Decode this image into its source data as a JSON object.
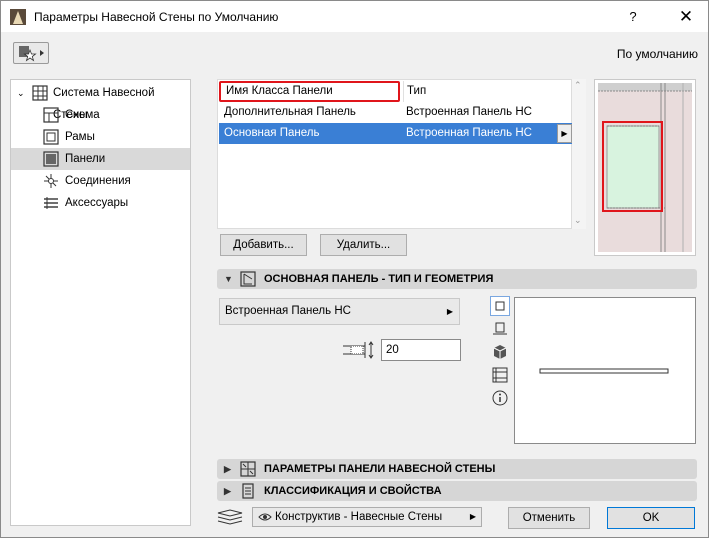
{
  "window": {
    "title": "Параметры Навесной Стены по Умолчанию",
    "help_label": "?",
    "close_label": "✕"
  },
  "header": {
    "default_label": "По умолчанию"
  },
  "tree": {
    "root_label": "Система Навесной Стены",
    "items": [
      {
        "label": "Схема",
        "icon": "scheme-icon"
      },
      {
        "label": "Рамы",
        "icon": "frames-icon"
      },
      {
        "label": "Панели",
        "icon": "panels-icon",
        "selected": true
      },
      {
        "label": "Соединения",
        "icon": "junctions-icon"
      },
      {
        "label": "Аксессуары",
        "icon": "accessories-icon"
      }
    ]
  },
  "panel_table": {
    "col_name": "Имя Класса Панели",
    "col_type": "Тип",
    "rows": [
      {
        "name": "Дополнительная Панель",
        "type": "Встроенная Панель НС",
        "selected": false
      },
      {
        "name": "Основная Панель",
        "type": "Встроенная Панель НС",
        "selected": true
      }
    ]
  },
  "buttons": {
    "add": "Добавить...",
    "delete": "Удалить...",
    "cancel": "Отменить",
    "ok": "OK"
  },
  "sections": {
    "type_geometry": "ОСНОВНАЯ ПАНЕЛЬ - ТИП И ГЕОМЕТРИЯ",
    "panel_params": "ПАРАМЕТРЫ ПАНЕЛИ НАВЕСНОЙ СТЕНЫ",
    "classification": "КЛАССИФИКАЦИЯ И СВОЙСТВА"
  },
  "geometry": {
    "panel_type": "Встроенная Панель НС",
    "thickness": "20"
  },
  "footer": {
    "layer": "Конструктив - Навесные Стены"
  },
  "colors": {
    "highlight_red": "#e0151b",
    "selection_blue": "#3a7fd5",
    "panel_green": "#d8f3df"
  }
}
